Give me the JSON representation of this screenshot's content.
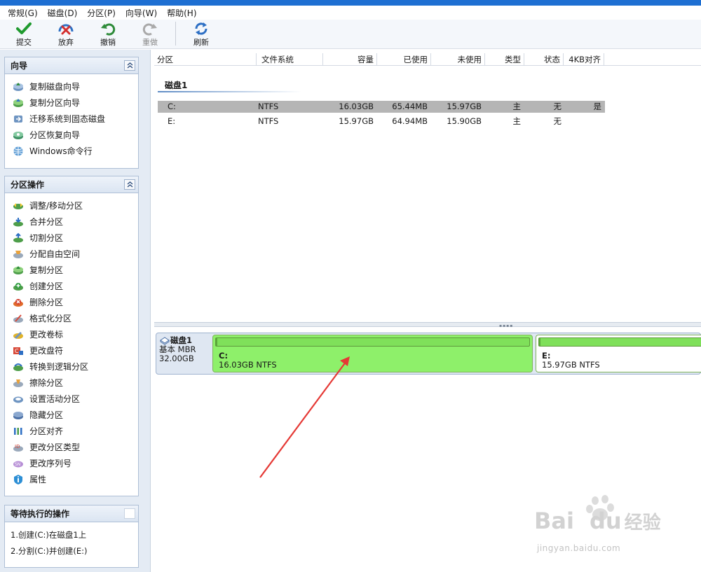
{
  "menu": [
    "常规(G)",
    "磁盘(D)",
    "分区(P)",
    "向导(W)",
    "帮助(H)"
  ],
  "toolbar": {
    "commit": "提交",
    "discard": "放弃",
    "undo": "撤销",
    "redo": "重做",
    "refresh": "刷新"
  },
  "wizard_panel": {
    "title": "向导",
    "items": [
      "复制磁盘向导",
      "复制分区向导",
      "迁移系统到固态磁盘",
      "分区恢复向导",
      "Windows命令行"
    ]
  },
  "ops_panel": {
    "title": "分区操作",
    "items": [
      "调整/移动分区",
      "合并分区",
      "切割分区",
      "分配自由空间",
      "复制分区",
      "创建分区",
      "删除分区",
      "格式化分区",
      "更改卷标",
      "更改盘符",
      "转换到逻辑分区",
      "擦除分区",
      "设置活动分区",
      "隐藏分区",
      "分区对齐",
      "更改分区类型",
      "更改序列号",
      "属性"
    ]
  },
  "pending_panel": {
    "title": "等待执行的操作",
    "items": [
      "1.创建(C:)在磁盘1上",
      "2.分割(C:)并创建(E:)"
    ]
  },
  "columns": [
    "分区",
    "文件系统",
    "容量",
    "已使用",
    "未使用",
    "类型",
    "状态",
    "4KB对齐"
  ],
  "disk_group": "磁盘1",
  "partitions": [
    {
      "name": "C:",
      "fs": "NTFS",
      "capacity": "16.03GB",
      "used": "65.44MB",
      "free": "15.97GB",
      "type": "主",
      "status": "无",
      "align": "是"
    },
    {
      "name": "E:",
      "fs": "NTFS",
      "capacity": "15.97GB",
      "used": "64.94MB",
      "free": "15.90GB",
      "type": "主",
      "status": "无",
      "align": ""
    }
  ],
  "disk_map": {
    "name": "磁盘1",
    "type": "基本 MBR",
    "size": "32.00GB",
    "parts": [
      {
        "letter": "C:",
        "detail": "16.03GB NTFS",
        "used_fraction": 0.004
      },
      {
        "letter": "E:",
        "detail": "15.97GB NTFS",
        "used_fraction": 0.004
      }
    ]
  },
  "watermark": {
    "brand": "Bai",
    "brand2": "du",
    "cn": "经验",
    "url": "jingyan.baidu.com"
  },
  "colors": {
    "partition_fill": "#8ef06a",
    "selected_row": "#b5b5b5",
    "arrow": "#e53935"
  }
}
